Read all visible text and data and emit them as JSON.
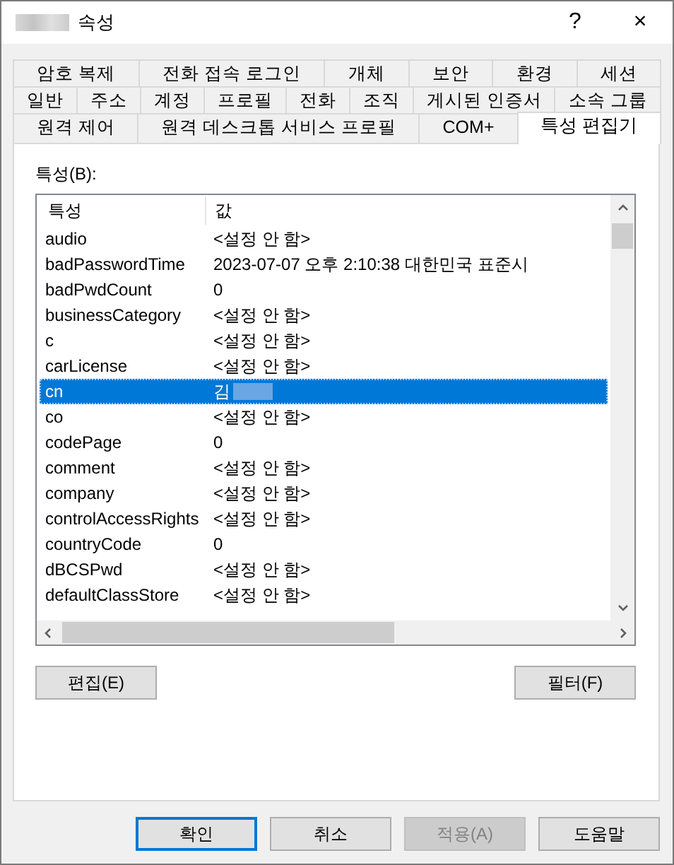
{
  "window": {
    "title": "속성",
    "title_redacted": true,
    "help": "?",
    "close": "×"
  },
  "tab_rows": [
    [
      {
        "label": "암호 복제",
        "selected": false
      },
      {
        "label": "전화 접속 로그인",
        "selected": false
      },
      {
        "label": "개체",
        "selected": false
      },
      {
        "label": "보안",
        "selected": false
      },
      {
        "label": "환경",
        "selected": false
      },
      {
        "label": "세션",
        "selected": false
      }
    ],
    [
      {
        "label": "일반",
        "selected": false
      },
      {
        "label": "주소",
        "selected": false
      },
      {
        "label": "계정",
        "selected": false
      },
      {
        "label": "프로필",
        "selected": false
      },
      {
        "label": "전화",
        "selected": false
      },
      {
        "label": "조직",
        "selected": false
      },
      {
        "label": "게시된 인증서",
        "selected": false
      },
      {
        "label": "소속 그룹",
        "selected": false
      }
    ],
    [
      {
        "label": "원격 제어",
        "selected": false
      },
      {
        "label": "원격 데스크톱 서비스 프로필",
        "selected": false
      },
      {
        "label": "COM+",
        "selected": false
      },
      {
        "label": "특성 편집기",
        "selected": true
      }
    ]
  ],
  "attributes_label": "특성(B):",
  "table": {
    "columns": [
      "특성",
      "값"
    ],
    "rows": [
      {
        "attribute": "audio",
        "value": "<설정 안 함>",
        "selected": false
      },
      {
        "attribute": "badPasswordTime",
        "value": "2023-07-07 오후 2:10:38 대한민국 표준시",
        "selected": false
      },
      {
        "attribute": "badPwdCount",
        "value": "0",
        "selected": false
      },
      {
        "attribute": "businessCategory",
        "value": "<설정 안 함>",
        "selected": false
      },
      {
        "attribute": "c",
        "value": "<설정 안 함>",
        "selected": false
      },
      {
        "attribute": "carLicense",
        "value": "<설정 안 함>",
        "selected": false
      },
      {
        "attribute": "cn",
        "value": "김",
        "selected": true,
        "redacted": true
      },
      {
        "attribute": "co",
        "value": "<설정 안 함>",
        "selected": false
      },
      {
        "attribute": "codePage",
        "value": "0",
        "selected": false
      },
      {
        "attribute": "comment",
        "value": "<설정 안 함>",
        "selected": false
      },
      {
        "attribute": "company",
        "value": "<설정 안 함>",
        "selected": false
      },
      {
        "attribute": "controlAccessRights",
        "value": "<설정 안 함>",
        "selected": false
      },
      {
        "attribute": "countryCode",
        "value": "0",
        "selected": false
      },
      {
        "attribute": "dBCSPwd",
        "value": "<설정 안 함>",
        "selected": false
      },
      {
        "attribute": "defaultClassStore",
        "value": "<설정 안 함>",
        "selected": false
      }
    ]
  },
  "actions": [
    "편집(E)",
    "필터(F)"
  ],
  "footer_buttons": [
    {
      "label": "확인",
      "default": true,
      "disabled": false
    },
    {
      "label": "취소",
      "default": false,
      "disabled": false
    },
    {
      "label": "적용(A)",
      "default": false,
      "disabled": true
    },
    {
      "label": "도움말",
      "default": false,
      "disabled": false
    }
  ]
}
